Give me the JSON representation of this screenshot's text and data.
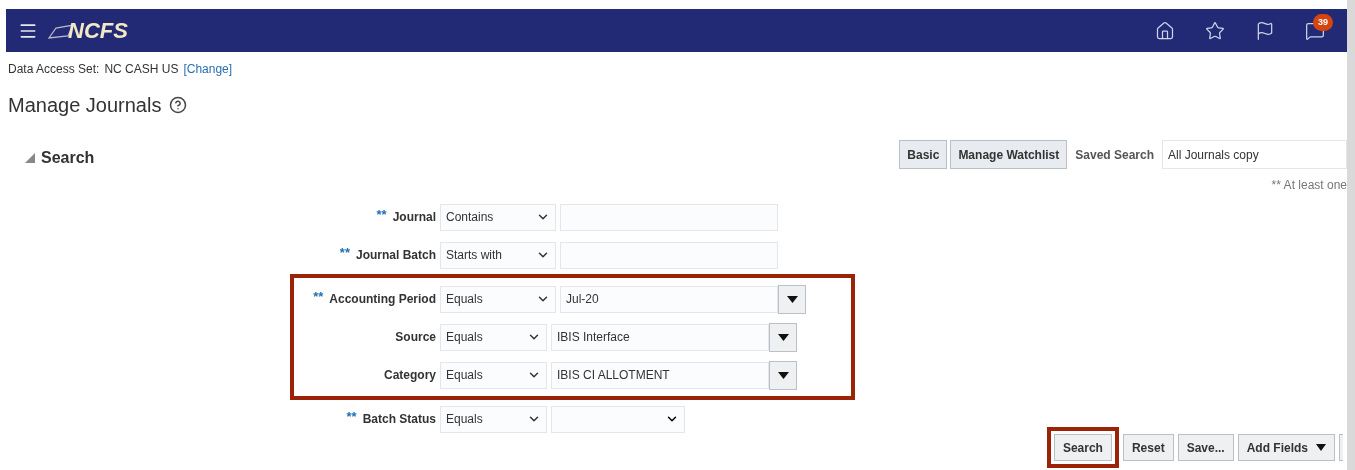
{
  "header": {
    "logo_text": "NCFS",
    "notification_count": "39"
  },
  "data_access": {
    "label": "Data Access Set:",
    "value": "NC CASH US",
    "link": "[Change]"
  },
  "page_title": "Manage Journals",
  "search_panel": {
    "title": "Search",
    "expanded": true,
    "toolbar_buttons": [
      {
        "label": "Basic"
      },
      {
        "label": "Manage Watchlist"
      }
    ],
    "saved_search": {
      "label": "Saved Search",
      "value": "All Journals copy"
    },
    "note": "** At least one",
    "fields": [
      {
        "label": "Journal",
        "required": true,
        "operator": "Contains",
        "kind": "text",
        "highlighted": false
      },
      {
        "label": "Journal Batch",
        "required": true,
        "operator": "Starts with",
        "kind": "text",
        "highlighted": false
      },
      {
        "label": "Accounting Period",
        "required": true,
        "operator": "Equals",
        "kind": "lov",
        "value": "Jul-20",
        "highlighted": true
      },
      {
        "label": "Source",
        "required": false,
        "operator": "Equals",
        "kind": "lov",
        "value": "IBIS Interface",
        "highlighted": true
      },
      {
        "label": "Category",
        "required": false,
        "operator": "Equals",
        "kind": "lov",
        "value": "IBIS CI ALLOTMENT",
        "highlighted": true
      },
      {
        "label": "Batch Status",
        "required": true,
        "operator": "Equals",
        "kind": "select",
        "highlighted": false
      }
    ],
    "required_mark": "**",
    "actions": [
      {
        "label": "Search",
        "highlighted": true
      },
      {
        "label": "Reset",
        "highlighted": false
      },
      {
        "label": "Save...",
        "highlighted": false
      },
      {
        "label": "Add Fields",
        "highlighted": false,
        "menu": true
      }
    ]
  }
}
